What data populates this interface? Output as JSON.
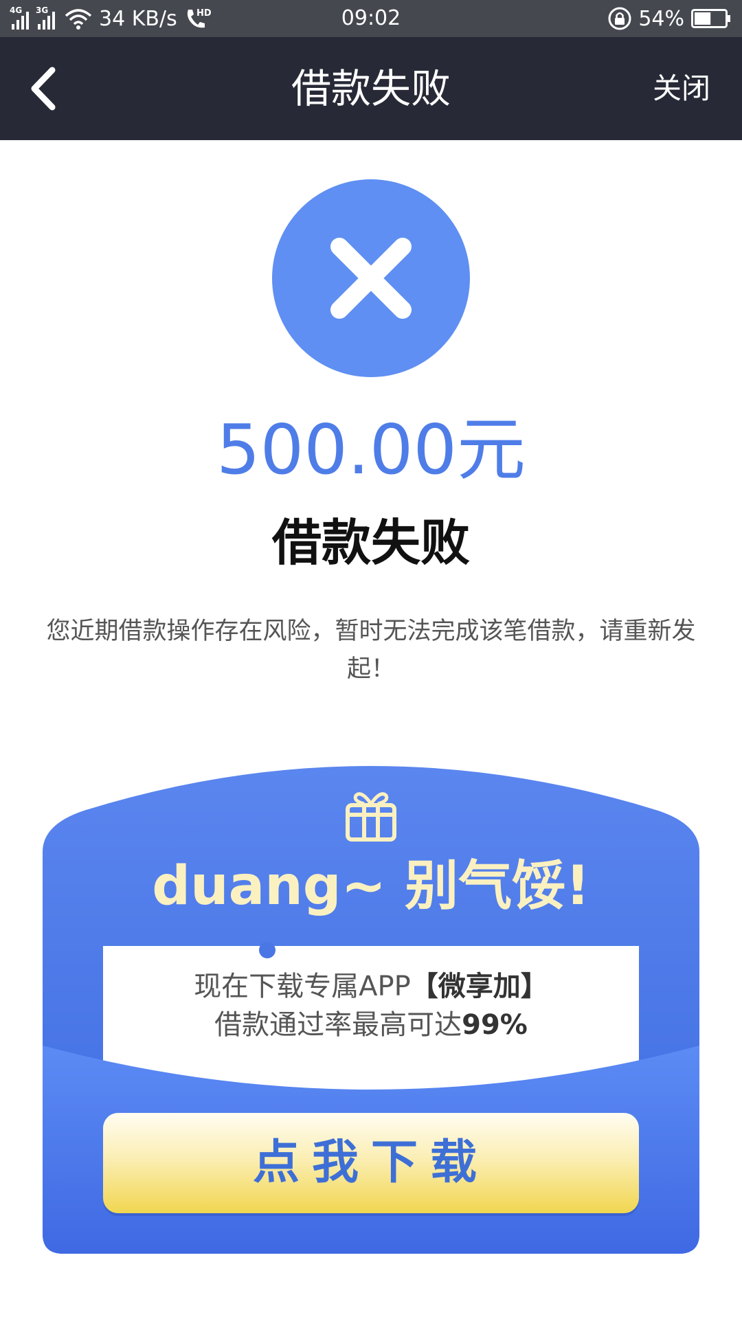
{
  "status_bar": {
    "net1": "4G",
    "net2": "3G",
    "speed": "34 KB/s",
    "hd": "HD",
    "time": "09:02",
    "battery": "54%",
    "battery_level": 0.54
  },
  "nav": {
    "title": "借款失败",
    "close_label": "关闭"
  },
  "result": {
    "amount": "500.00元",
    "title": "借款失败",
    "description": "您近期借款操作存在风险，暂时无法完成该笔借款，请重新发起！"
  },
  "promo": {
    "headline": "duang~ 别气馁!",
    "line1_prefix": "现在下载专属APP",
    "line1_app": "【微享加】",
    "line2_prefix": "借款通过率最高可达",
    "line2_rate": "99%",
    "button_label": "点我下载"
  },
  "colors": {
    "status_bar_bg": "#45484f",
    "nav_bg": "#272a36",
    "accent_blue": "#5f8ff2",
    "amount_blue": "#4f7de8",
    "button_yellow": "#f1d650"
  },
  "icons": {
    "back": "chevron-left-icon",
    "fail": "close-icon",
    "gift": "gift-icon",
    "wifi": "wifi-icon",
    "call": "hd-call-icon",
    "lock": "rotation-lock-icon",
    "battery": "battery-icon"
  }
}
